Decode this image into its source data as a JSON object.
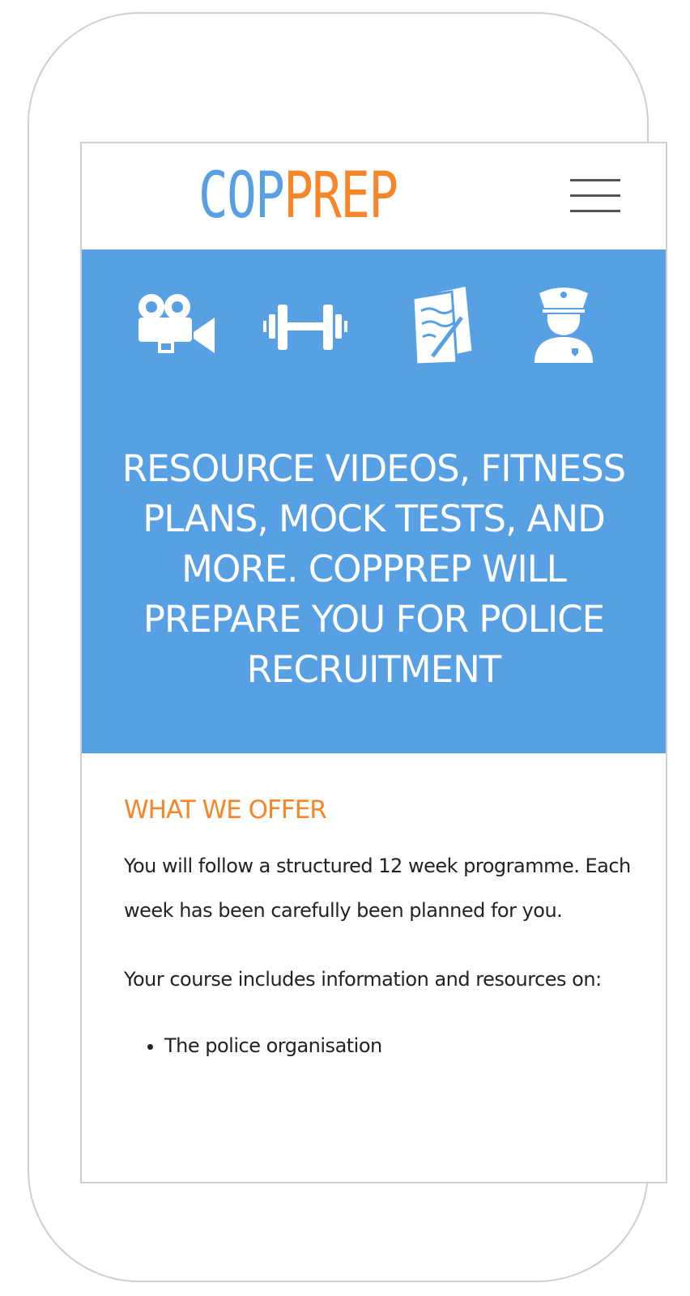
{
  "header": {
    "logo_part1": "COP",
    "logo_part2": "PREP",
    "menu_icon": "hamburger-menu-icon"
  },
  "hero": {
    "icons": [
      "movie-camera-icon",
      "dumbbell-icon",
      "documents-icon",
      "police-officer-icon"
    ],
    "title": "RESOURCE VIDEOS, FITNESS PLANS, MOCK TESTS, AND MORE. COPPREP WILL PREPARE YOU FOR POLICE RECRUITMENT"
  },
  "offer": {
    "heading": "WHAT WE OFFER",
    "paragraph1": "You will follow a structured 12 week programme. Each week has been carefully been planned for you.",
    "paragraph2": "Your course includes information and resources on:",
    "items": [
      "The police organisation"
    ]
  },
  "colors": {
    "brand_blue": "#56a0e3",
    "brand_orange": "#f5872a",
    "text": "#222222"
  }
}
